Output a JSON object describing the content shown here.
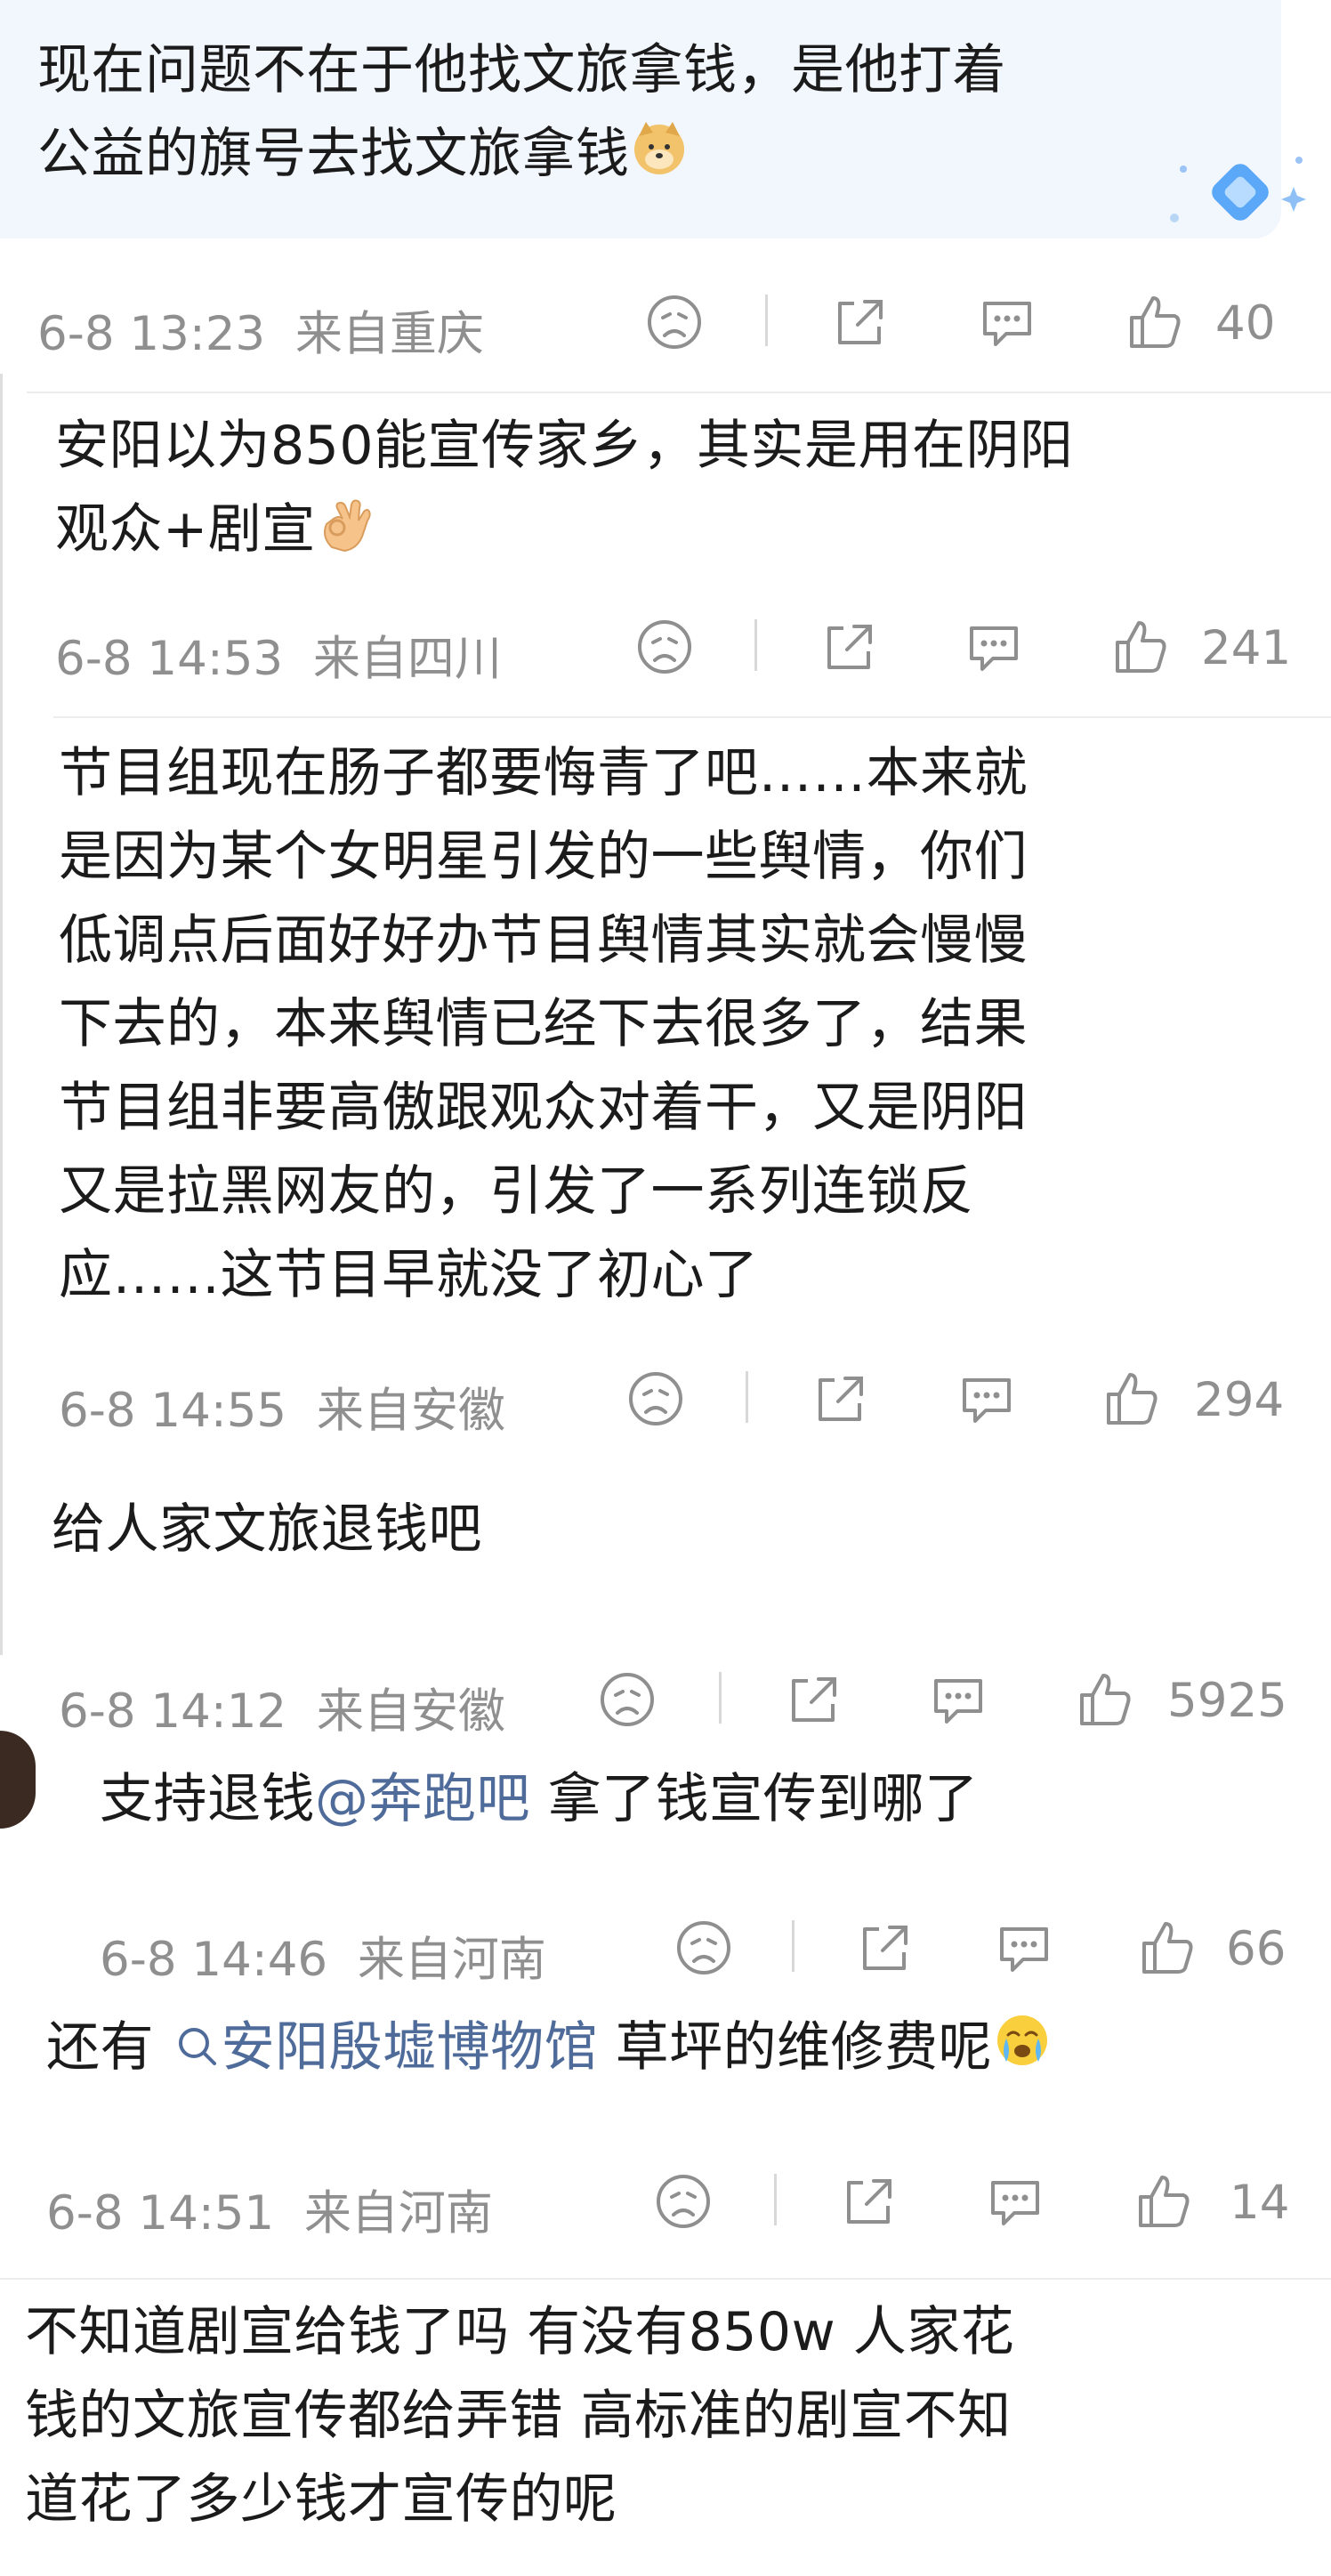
{
  "comments": [
    {
      "lines": [
        "现在问题不在于他找文旅拿钱，是他打着",
        "公益的旗号去找文旅拿钱"
      ],
      "emoji": "doge-emoji",
      "time": "6-8 13:23",
      "location": "来自重庆",
      "likes": "40"
    },
    {
      "lines": [
        "安阳以为850能宣传家乡，其实是用在阴阳",
        "观众+剧宣"
      ],
      "emoji": "ok-hand-emoji",
      "time": "6-8 14:53",
      "location": "来自四川",
      "likes": "241"
    },
    {
      "lines": [
        "节目组现在肠子都要悔青了吧……本来就",
        "是因为某个女明星引发的一些舆情，你们",
        "低调点后面好好办节目舆情其实就会慢慢",
        "下去的，本来舆情已经下去很多了，结果",
        "节目组非要高傲跟观众对着干，又是阴阳",
        "又是拉黑网友的，引发了一系列连锁反",
        "应……这节目早就没了初心了"
      ],
      "time": "6-8 14:55",
      "location": "来自安徽",
      "likes": "294"
    },
    {
      "lines": [
        "给人家文旅退钱吧"
      ],
      "time": "6-8 14:12",
      "location": "来自安徽",
      "likes": "5925"
    },
    {
      "prefix": "支持退钱",
      "mention": "@奔跑吧",
      "suffix": " 拿了钱宣传到哪了",
      "time": "6-8 14:46",
      "location": "来自河南",
      "likes": "66"
    },
    {
      "prefix": "还有 ",
      "search_link": "安阳殷墟博物馆",
      "suffix": " 草坪的维修费呢",
      "emoji": "crying-emoji",
      "time": "6-8 14:51",
      "location": "来自河南",
      "likes": "14"
    },
    {
      "lines": [
        "不知道剧宣给钱了吗 有没有850w 人家花",
        "钱的文旅宣传都给弄错  高标准的剧宣不知",
        "道花了多少钱才宣传的呢"
      ]
    }
  ],
  "icons": {
    "dislike": "sad-face-icon",
    "share": "share-icon",
    "reply": "comment-icon",
    "like": "thumbs-up-icon"
  },
  "colors": {
    "link": "#4f6b9a",
    "meta": "#8f8f8f",
    "highlight": "#f2f6fd"
  }
}
